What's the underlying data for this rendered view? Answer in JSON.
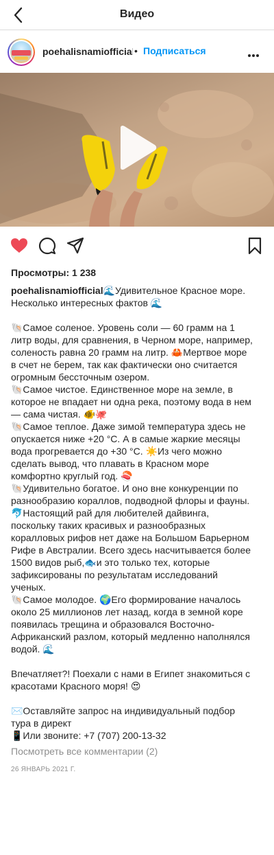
{
  "topbar": {
    "title": "Видео"
  },
  "post": {
    "username": "poehalisnamiofficial",
    "separator": "•",
    "follow_label": "Подписаться",
    "views": "Просмотры: 1 238",
    "caption_username": "poehalisnamiofficial",
    "caption_lines": [
      "🌊Удивительное Красное море.",
      "Несколько интересных фактов 🌊",
      "",
      "🐚Самое соленое. Уровень соли — 60 грамм на 1",
      "литр воды, для сравнения, в Черном море, например,",
      "соленость равна 20 грамм на литр. 🦀Мертвое море",
      "в счет не берем, так как фактически оно считается",
      "огромным бессточным озером.",
      "🐚Самое чистое. Единственное море на земле, в",
      "которое не впадает ни одна река, поэтому вода в нем",
      "— сама чистая. 🐠🐙",
      "🐚Самое теплое. Даже зимой температура здесь не",
      "опускается ниже +20 °С. А в самые жаркие месяцы",
      "вода прогревается до +30 °С. ☀️Из чего можно",
      "сделать вывод, что плавать в Красном море",
      "комфортно круглый год. 🍣",
      "🐚Удивительно богатое. И оно вне конкуренции по",
      "разнообразию кораллов, подводной флоры и фауны.",
      "🐬Настоящий рай для любителей дайвинга,",
      "поскольку таких красивых и разнообразных",
      "коралловых рифов нет даже на Большом Барьерном",
      "Рифе в Австралии. Всего здесь насчитывается более",
      "1500 видов рыб,🐟и это только тех, которые",
      "зафиксированы по результатам исследований",
      "ученых.",
      "🐚Самое молодое. 🌍Его формирование началось",
      "около 25 миллионов лет назад, когда в земной коре",
      "появилась трещина и образовался Восточно-",
      "Африканский разлом, который медленно наполнялся",
      "водой. 🌊",
      "",
      "Впечатляет?! Поехали с нами в Египет знакомиться с",
      "красотами Красного моря! 😍",
      "",
      "✉️Оставляйте запрос на индивидуальный подбор",
      "тура в директ",
      "📱Или звоните: +7 (707) 200-13-32"
    ],
    "comments_link": "Посмотреть все комментарии (2)",
    "date": "26 ЯНВАРЬ 2021 Г."
  },
  "icons": {
    "back": "chevron-left-icon",
    "more": "more-horizontal-icon",
    "play": "play-icon",
    "like": "heart-filled-icon",
    "comment": "comment-icon",
    "share": "paper-plane-icon",
    "save": "bookmark-icon"
  },
  "colors": {
    "like": "#ed4956",
    "follow": "#0095f6",
    "muted": "#8e8e8e"
  }
}
